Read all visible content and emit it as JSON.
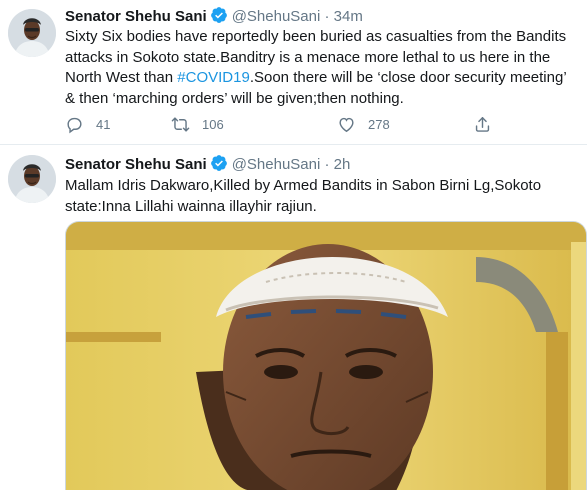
{
  "tweets": [
    {
      "author": "Senator Shehu Sani",
      "handle": "@ShehuSani",
      "separator": "·",
      "time": "34m",
      "text_before": "Sixty Six bodies have reportedly been buried as casualties from the Bandits attacks in Sokoto state.Banditry is a menace more lethal to us here in the North West than ",
      "hashtag": "#COVID19",
      "text_after": ".Soon there will be ‘close door security meeting’ & then ‘marching orders’ will be given;then nothing.",
      "replies": "41",
      "retweets": "106",
      "likes": "278",
      "icons": [
        "reply-icon",
        "retweet-icon",
        "like-icon",
        "share-icon"
      ]
    },
    {
      "author": "Senator Shehu Sani",
      "handle": "@ShehuSani",
      "separator": "·",
      "time": "2h",
      "text": "Mallam Idris Dakwaro,Killed by Armed Bandits in Sabon Birni Lg,Sokoto state:Inna Lillahi wainna illayhir rajiun."
    }
  ],
  "colors": {
    "verified": "#1da1f2",
    "hashtag": "#1b95e0",
    "muted": "#657786"
  }
}
